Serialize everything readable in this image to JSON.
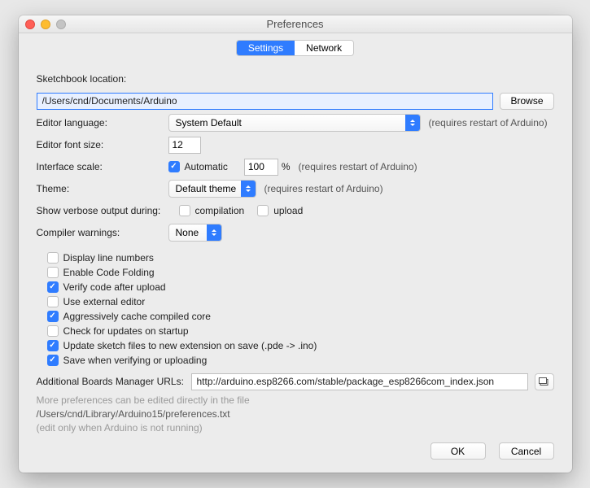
{
  "window": {
    "title": "Preferences"
  },
  "tabs": {
    "settings": "Settings",
    "network": "Network"
  },
  "labels": {
    "sketchbook": "Sketchbook location:",
    "editor_lang": "Editor language:",
    "font_size": "Editor font size:",
    "iface_scale": "Interface scale:",
    "theme": "Theme:",
    "verbose": "Show verbose output during:",
    "compiler_warn": "Compiler warnings:",
    "addl_urls": "Additional Boards Manager URLs:"
  },
  "values": {
    "sketchbook_path": "/Users/cnd/Documents/Arduino",
    "editor_lang": "System Default",
    "font_size": "12",
    "scale_pct": "100",
    "theme": "Default theme",
    "compiler_warn": "None",
    "addl_urls": "http://arduino.esp8266.com/stable/package_esp8266com_index.json"
  },
  "buttons": {
    "browse": "Browse",
    "ok": "OK",
    "cancel": "Cancel"
  },
  "notes": {
    "restart": "(requires restart of Arduino)",
    "pct": "%"
  },
  "checks": {
    "automatic": "Automatic",
    "compilation": "compilation",
    "upload": "upload",
    "line_numbers": "Display line numbers",
    "code_folding": "Enable Code Folding",
    "verify_upload": "Verify code after upload",
    "external_editor": "Use external editor",
    "cache_core": "Aggressively cache compiled core",
    "check_updates": "Check for updates on startup",
    "update_ext": "Update sketch files to new extension on save (.pde -> .ino)",
    "save_verify": "Save when verifying or uploading"
  },
  "hints": {
    "more": "More preferences can be edited directly in the file",
    "path": "/Users/cnd/Library/Arduino15/preferences.txt",
    "edit_only": "(edit only when Arduino is not running)"
  }
}
